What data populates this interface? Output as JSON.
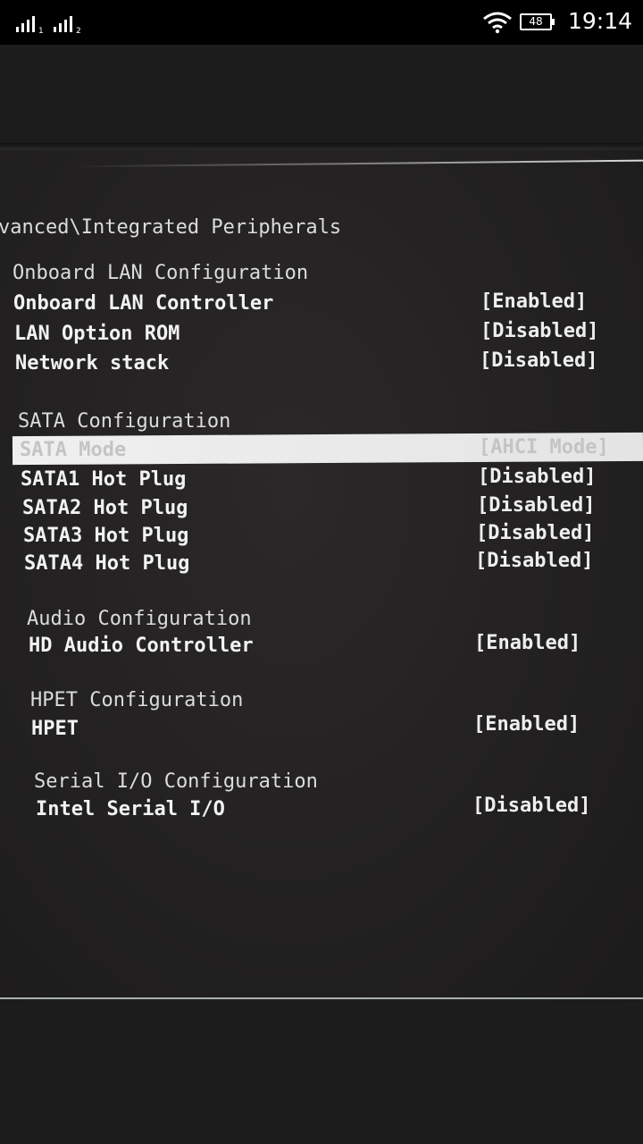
{
  "status_bar": {
    "sim1_label": "1",
    "sim2_label": "2",
    "battery": "48",
    "time": "19:14"
  },
  "bios": {
    "breadcrumb": "vanced\\Integrated Peripherals",
    "sections": [
      {
        "title": "Onboard LAN Configuration",
        "items": [
          {
            "label": "Onboard LAN Controller",
            "value": "[Enabled]"
          },
          {
            "label": "LAN Option ROM",
            "value": "[Disabled]"
          },
          {
            "label": "Network stack",
            "value": "[Disabled]"
          }
        ]
      },
      {
        "title": "SATA Configuration",
        "items": [
          {
            "label": "SATA Mode",
            "value": "[AHCI Mode]",
            "selected": true
          },
          {
            "label": "SATA1 Hot Plug",
            "value": "[Disabled]"
          },
          {
            "label": "SATA2 Hot Plug",
            "value": "[Disabled]"
          },
          {
            "label": "SATA3 Hot Plug",
            "value": "[Disabled]"
          },
          {
            "label": "SATA4 Hot Plug",
            "value": "[Disabled]"
          }
        ]
      },
      {
        "title": "Audio Configuration",
        "items": [
          {
            "label": "HD Audio Controller",
            "value": "[Enabled]"
          }
        ]
      },
      {
        "title": "HPET Configuration",
        "items": [
          {
            "label": "HPET",
            "value": "[Enabled]"
          }
        ]
      },
      {
        "title": "Serial I/O Configuration",
        "items": [
          {
            "label": "Intel Serial I/O",
            "value": "[Disabled]"
          }
        ]
      }
    ]
  }
}
